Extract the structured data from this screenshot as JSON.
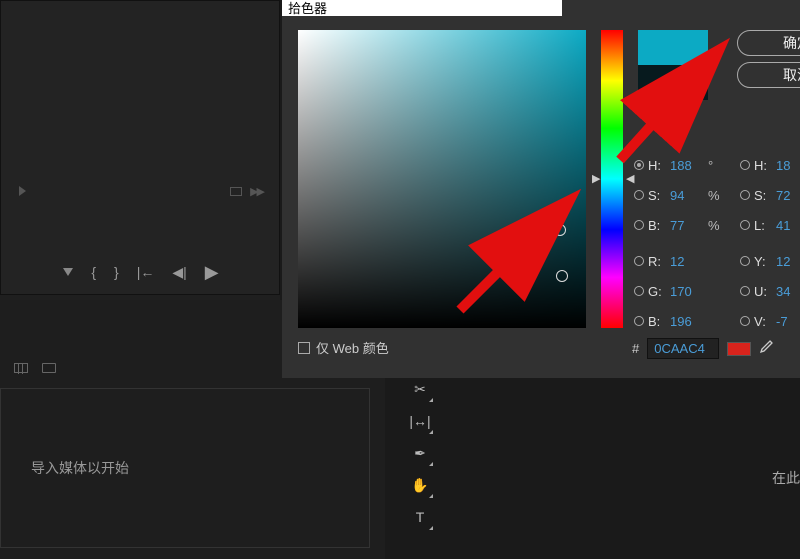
{
  "dialog": {
    "title": "拾色器",
    "confirm": "确定",
    "cancel": "取消",
    "web_only": "仅 Web 颜色"
  },
  "hsl": {
    "h_label": "H:",
    "h_value": "188",
    "h_unit": "°",
    "s_label": "S:",
    "s_value": "94",
    "s_unit": "%",
    "b_label": "B:",
    "b_value": "77",
    "b_unit": "%"
  },
  "rgb": {
    "r_label": "R:",
    "r_value": "12",
    "g_label": "G:",
    "g_value": "170",
    "b_label": "B:",
    "b_value": "196"
  },
  "hsl2": {
    "h_label": "H:",
    "h_value": "18",
    "s_label": "S:",
    "s_value": "72",
    "l_label": "L:",
    "l_value": "41"
  },
  "yuv": {
    "y_label": "Y:",
    "y_value": "12",
    "u_label": "U:",
    "u_value": "34",
    "v_label": "V:",
    "v_value": "-7"
  },
  "hex": {
    "prefix": "#",
    "value": "0CAAC4"
  },
  "colors": {
    "new": "#0CAAC4",
    "old": "#071a1e",
    "swatch": "#d8231c"
  },
  "left": {
    "import_hint": "导入媒体以开始"
  },
  "right": {
    "hint": "在此"
  }
}
